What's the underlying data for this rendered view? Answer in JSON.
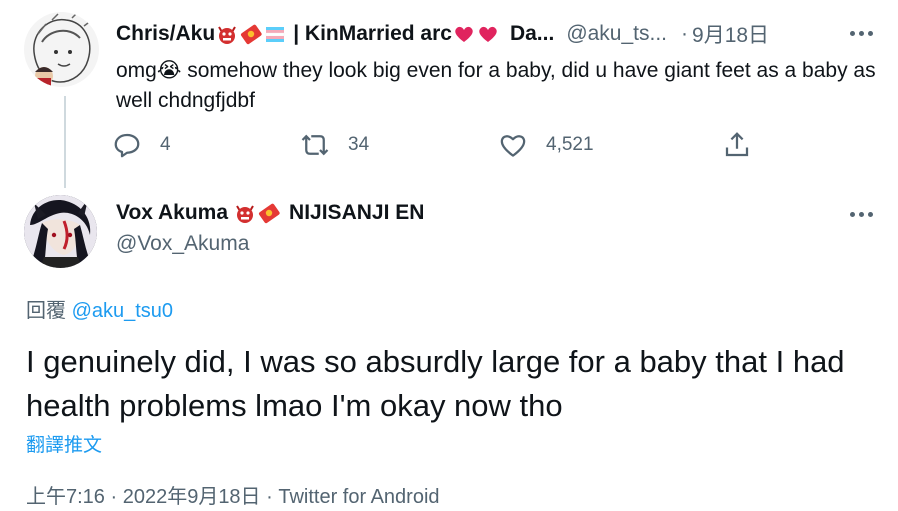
{
  "parent": {
    "name": "Chris/Aku",
    "name_suffix": "| KinMarried arc",
    "name_tail": "Da...",
    "handle": "@aku_ts...",
    "date": "9月18日",
    "text": "omg😭 somehow they look big even for a baby, did u have giant feet as a baby as well chdngfjdbf",
    "replies": "4",
    "retweets": "34",
    "likes": "4,521"
  },
  "main": {
    "name": "Vox Akuma",
    "name_suffix": "NIJISANJI EN",
    "handle": "@Vox_Akuma",
    "reply_prefix": "回覆",
    "reply_handle": "@aku_tsu0",
    "text": "I genuinely did, I was so absurdly large for a baby that I had health problems lmao I'm okay now tho",
    "translate_label": "翻譯推文",
    "meta": "上午7:16 · 2022年9月18日 · Twitter for Android"
  },
  "colors": {
    "text": "#0f1419",
    "secondary": "#536471",
    "link": "#1d9bf0",
    "thread_line": "#cfd9de",
    "heart": "#e0245e"
  },
  "icons": {
    "reply": "speech-bubble-icon",
    "retweet": "retweet-icon",
    "like": "heart-icon",
    "share": "share-icon",
    "more": "ellipsis-icon"
  }
}
